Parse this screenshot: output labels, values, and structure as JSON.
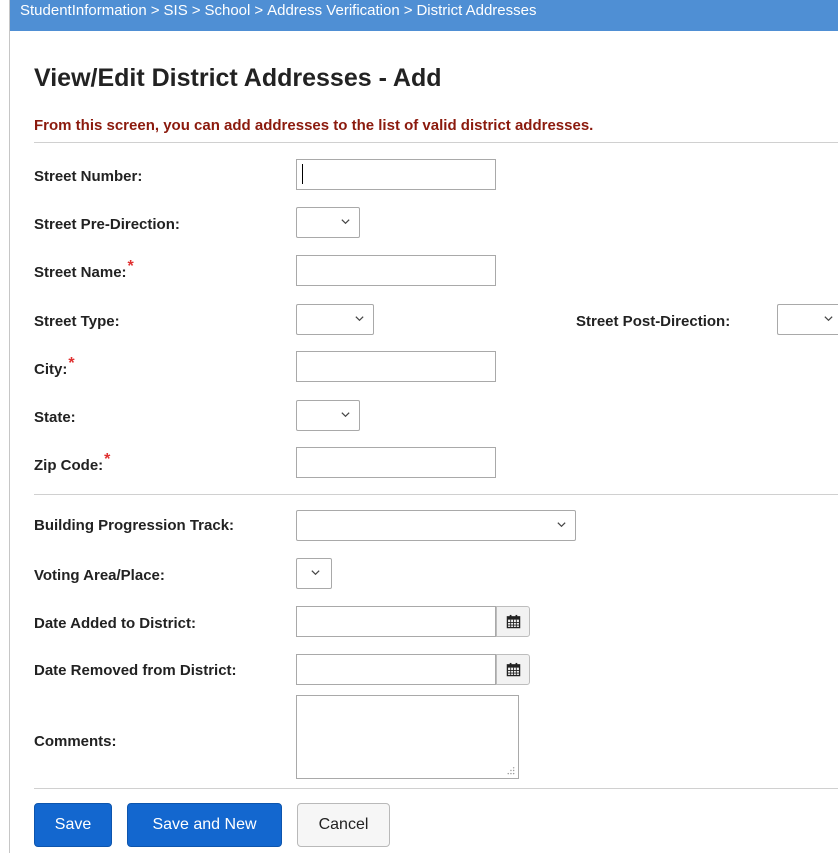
{
  "breadcrumb": [
    "StudentInformation",
    "SIS",
    "School",
    "Address Verification",
    "District Addresses"
  ],
  "breadcrumb_separator": ">",
  "page_title": "View/Edit District Addresses - Add",
  "instructions": "From this screen, you can add addresses to the list of valid district addresses.",
  "required_marker": "*",
  "fields": {
    "street_number": {
      "label": "Street Number:",
      "value": ""
    },
    "street_pre_direction": {
      "label": "Street Pre-Direction:",
      "selected": ""
    },
    "street_name": {
      "label": "Street Name:",
      "value": "",
      "required": true
    },
    "street_type": {
      "label": "Street Type:",
      "selected": ""
    },
    "street_post_direction": {
      "label": "Street Post-Direction:",
      "selected": ""
    },
    "city": {
      "label": "City:",
      "value": "",
      "required": true
    },
    "state": {
      "label": "State:",
      "selected": ""
    },
    "zip_code": {
      "label": "Zip Code:",
      "value": "",
      "required": true
    },
    "building_progression_track": {
      "label": "Building Progression Track:",
      "selected": ""
    },
    "voting_area_place": {
      "label": "Voting Area/Place:",
      "selected": ""
    },
    "date_added": {
      "label": "Date Added to District:",
      "value": ""
    },
    "date_removed": {
      "label": "Date Removed from District:",
      "value": ""
    },
    "comments": {
      "label": "Comments:",
      "value": ""
    }
  },
  "buttons": {
    "save": "Save",
    "save_and_new": "Save and New",
    "cancel": "Cancel"
  },
  "colors": {
    "breadcrumb_bg": "#4f8fd4",
    "instructions": "#8b1a0d",
    "required": "#e03030",
    "primary_button": "#1367cf"
  },
  "icons": {
    "calendar": "calendar-icon",
    "dropdown": "chevron-down-icon",
    "resize": "resize-handle-icon"
  }
}
